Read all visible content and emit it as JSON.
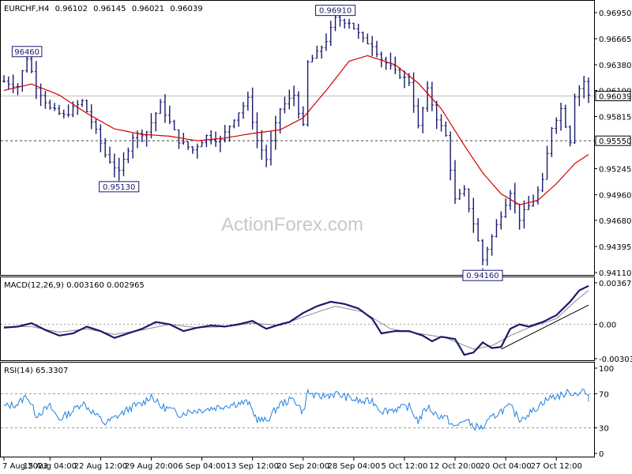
{
  "chart_data": [
    {
      "type": "candlestick",
      "header": {
        "symbol": "EURCHF,H4",
        "open": "0.96102",
        "high": "0.96145",
        "low": "0.96021",
        "close": "0.96039"
      },
      "y_ticks": [
        "0.96950",
        "0.96665",
        "0.96380",
        "0.96100",
        "0.95815",
        "0.95530",
        "0.95245",
        "0.94960",
        "0.94680",
        "0.94395",
        "0.94110"
      ],
      "ylim": [
        0.9411,
        0.9695
      ],
      "current_price": "0.96039",
      "horizontal_level": "0.95550",
      "annotations": [
        {
          "text": "0.96910",
          "value": 0.9691,
          "bar": 72
        },
        {
          "text": "96460",
          "value": 0.9646,
          "bar": 5
        },
        {
          "text": "0.95130",
          "value": 0.9513,
          "bar": 25
        },
        {
          "text": "0.94160",
          "value": 0.9416,
          "bar": 104
        }
      ],
      "x_ticks": [
        {
          "label": "7 Aug 2023",
          "bar": 0
        },
        {
          "label": "15 Aug 04:00",
          "bar": 10
        },
        {
          "label": "22 Aug 12:00",
          "bar": 21
        },
        {
          "label": "29 Aug 20:00",
          "bar": 32
        },
        {
          "label": "6 Sep 04:00",
          "bar": 43
        },
        {
          "label": "13 Sep 12:00",
          "bar": 54
        },
        {
          "label": "20 Sep 20:00",
          "bar": 65
        },
        {
          "label": "28 Sep 04:00",
          "bar": 76
        },
        {
          "label": "5 Oct 12:00",
          "bar": 87
        },
        {
          "label": "12 Oct 20:00",
          "bar": 98
        },
        {
          "label": "20 Oct 04:00",
          "bar": 109
        },
        {
          "label": "27 Oct 12:00",
          "bar": 120
        }
      ],
      "close_anchors": [
        [
          0,
          0.962
        ],
        [
          3,
          0.9615
        ],
        [
          5,
          0.9646
        ],
        [
          7,
          0.9615
        ],
        [
          10,
          0.959
        ],
        [
          13,
          0.9582
        ],
        [
          17,
          0.9598
        ],
        [
          20,
          0.9565
        ],
        [
          22,
          0.954
        ],
        [
          25,
          0.952
        ],
        [
          28,
          0.956
        ],
        [
          31,
          0.9565
        ],
        [
          34,
          0.9595
        ],
        [
          36,
          0.9575
        ],
        [
          38,
          0.9555
        ],
        [
          41,
          0.9545
        ],
        [
          44,
          0.956
        ],
        [
          47,
          0.9555
        ],
        [
          50,
          0.958
        ],
        [
          53,
          0.96
        ],
        [
          55,
          0.9555
        ],
        [
          57,
          0.9535
        ],
        [
          60,
          0.959
        ],
        [
          63,
          0.9605
        ],
        [
          65,
          0.957
        ],
        [
          66,
          0.964
        ],
        [
          68,
          0.965
        ],
        [
          70,
          0.9665
        ],
        [
          72,
          0.9688
        ],
        [
          75,
          0.9685
        ],
        [
          78,
          0.9665
        ],
        [
          80,
          0.966
        ],
        [
          82,
          0.9645
        ],
        [
          85,
          0.963
        ],
        [
          88,
          0.962
        ],
        [
          90,
          0.957
        ],
        [
          92,
          0.961
        ],
        [
          94,
          0.958
        ],
        [
          96,
          0.956
        ],
        [
          98,
          0.949
        ],
        [
          100,
          0.95
        ],
        [
          102,
          0.9465
        ],
        [
          104,
          0.9425
        ],
        [
          106,
          0.945
        ],
        [
          108,
          0.9475
        ],
        [
          110,
          0.95
        ],
        [
          112,
          0.947
        ],
        [
          115,
          0.949
        ],
        [
          117,
          0.951
        ],
        [
          119,
          0.957
        ],
        [
          121,
          0.959
        ],
        [
          123,
          0.9555
        ],
        [
          124,
          0.9605
        ],
        [
          126,
          0.962
        ],
        [
          127,
          0.9604
        ]
      ],
      "ma_anchors": [
        [
          0,
          0.961
        ],
        [
          6,
          0.9617
        ],
        [
          12,
          0.9605
        ],
        [
          18,
          0.9585
        ],
        [
          24,
          0.9568
        ],
        [
          30,
          0.9562
        ],
        [
          36,
          0.956
        ],
        [
          42,
          0.9555
        ],
        [
          48,
          0.9558
        ],
        [
          54,
          0.9563
        ],
        [
          60,
          0.9567
        ],
        [
          65,
          0.958
        ],
        [
          70,
          0.961
        ],
        [
          75,
          0.9642
        ],
        [
          79,
          0.9648
        ],
        [
          85,
          0.9638
        ],
        [
          90,
          0.9618
        ],
        [
          95,
          0.959
        ],
        [
          100,
          0.955
        ],
        [
          104,
          0.952
        ],
        [
          108,
          0.9497
        ],
        [
          112,
          0.9485
        ],
        [
          116,
          0.949
        ],
        [
          120,
          0.9508
        ],
        [
          124,
          0.953
        ],
        [
          127,
          0.954
        ]
      ],
      "total_bars": 128
    },
    {
      "type": "line",
      "title": "MACD(12,26,9) 0.003160 0.002965",
      "y_ticks": [
        "0.00367",
        "0.00",
        "-0.003038"
      ],
      "ylim": [
        -0.003038,
        0.00367
      ],
      "macd_anchors": [
        [
          0,
          -0.0003
        ],
        [
          3,
          -0.0002
        ],
        [
          6,
          0.0001
        ],
        [
          9,
          -0.0005
        ],
        [
          12,
          -0.001
        ],
        [
          15,
          -0.0008
        ],
        [
          18,
          -0.0002
        ],
        [
          21,
          -0.0006
        ],
        [
          24,
          -0.0012
        ],
        [
          27,
          -0.0008
        ],
        [
          30,
          -0.0004
        ],
        [
          33,
          0.0002
        ],
        [
          36,
          0.0
        ],
        [
          39,
          -0.0006
        ],
        [
          42,
          -0.0003
        ],
        [
          45,
          -0.0001
        ],
        [
          48,
          -0.0002
        ],
        [
          51,
          0.0
        ],
        [
          54,
          0.0003
        ],
        [
          57,
          -0.0004
        ],
        [
          60,
          0.0
        ],
        [
          62,
          0.0002
        ],
        [
          65,
          0.001
        ],
        [
          68,
          0.0016
        ],
        [
          71,
          0.002
        ],
        [
          74,
          0.0018
        ],
        [
          77,
          0.0014
        ],
        [
          80,
          0.0005
        ],
        [
          82,
          -0.0008
        ],
        [
          85,
          -0.0006
        ],
        [
          88,
          -0.0006
        ],
        [
          91,
          -0.001
        ],
        [
          93,
          -0.0015
        ],
        [
          95,
          -0.0011
        ],
        [
          98,
          -0.0013
        ],
        [
          100,
          -0.0027
        ],
        [
          102,
          -0.0025
        ],
        [
          104,
          -0.0016
        ],
        [
          106,
          -0.0021
        ],
        [
          108,
          -0.002
        ],
        [
          110,
          -0.0004
        ],
        [
          112,
          0.0
        ],
        [
          114,
          -0.0002
        ],
        [
          117,
          0.0002
        ],
        [
          120,
          0.0008
        ],
        [
          123,
          0.002
        ],
        [
          125,
          0.003
        ],
        [
          127,
          0.0034
        ]
      ],
      "signal_anchors": [
        [
          0,
          -0.0002
        ],
        [
          6,
          -0.0002
        ],
        [
          12,
          -0.0007
        ],
        [
          18,
          -0.0004
        ],
        [
          24,
          -0.0009
        ],
        [
          30,
          -0.0005
        ],
        [
          36,
          0.0
        ],
        [
          42,
          -0.0003
        ],
        [
          48,
          -0.0002
        ],
        [
          54,
          0.0001
        ],
        [
          60,
          -0.0001
        ],
        [
          66,
          0.0008
        ],
        [
          72,
          0.0016
        ],
        [
          78,
          0.0011
        ],
        [
          84,
          -0.0004
        ],
        [
          90,
          -0.0008
        ],
        [
          96,
          -0.0012
        ],
        [
          102,
          -0.0022
        ],
        [
          106,
          -0.0019
        ],
        [
          110,
          -0.001
        ],
        [
          114,
          -0.0003
        ],
        [
          120,
          0.0005
        ],
        [
          124,
          0.002
        ],
        [
          127,
          0.003
        ]
      ],
      "trendline": {
        "from": [
          108,
          -0.0022
        ],
        "to": [
          127,
          0.0017
        ]
      }
    },
    {
      "type": "line",
      "title": "RSI(14) 65.3307",
      "y_ticks": [
        "100",
        "70",
        "30",
        "0"
      ],
      "ylim": [
        0,
        100
      ],
      "levels": [
        70,
        30
      ],
      "rsi_anchors": [
        [
          0,
          55
        ],
        [
          3,
          58
        ],
        [
          5,
          68
        ],
        [
          7,
          45
        ],
        [
          10,
          55
        ],
        [
          12,
          40
        ],
        [
          15,
          50
        ],
        [
          17,
          60
        ],
        [
          20,
          45
        ],
        [
          22,
          35
        ],
        [
          25,
          45
        ],
        [
          28,
          55
        ],
        [
          30,
          58
        ],
        [
          32,
          68
        ],
        [
          34,
          55
        ],
        [
          36,
          52
        ],
        [
          38,
          46
        ],
        [
          41,
          50
        ],
        [
          44,
          52
        ],
        [
          47,
          55
        ],
        [
          50,
          58
        ],
        [
          53,
          60
        ],
        [
          55,
          40
        ],
        [
          57,
          38
        ],
        [
          60,
          58
        ],
        [
          63,
          64
        ],
        [
          65,
          48
        ],
        [
          66,
          72
        ],
        [
          68,
          66
        ],
        [
          70,
          68
        ],
        [
          72,
          70
        ],
        [
          75,
          65
        ],
        [
          78,
          60
        ],
        [
          80,
          62
        ],
        [
          82,
          50
        ],
        [
          85,
          52
        ],
        [
          88,
          55
        ],
        [
          90,
          38
        ],
        [
          92,
          55
        ],
        [
          94,
          45
        ],
        [
          96,
          42
        ],
        [
          98,
          30
        ],
        [
          100,
          40
        ],
        [
          102,
          32
        ],
        [
          104,
          30
        ],
        [
          106,
          42
        ],
        [
          108,
          50
        ],
        [
          110,
          55
        ],
        [
          112,
          40
        ],
        [
          115,
          50
        ],
        [
          117,
          60
        ],
        [
          119,
          66
        ],
        [
          121,
          68
        ],
        [
          123,
          72
        ],
        [
          124,
          70
        ],
        [
          126,
          74
        ],
        [
          127,
          65
        ]
      ]
    }
  ],
  "watermark": "ActionForex.com",
  "colors": {
    "candle": "#1a1a6e",
    "ma": "#d40000",
    "macd": "#1a1a6e",
    "signal": "#8a8a8a",
    "rsi": "#2080e0",
    "grid": "#9a9a9a",
    "level": "#9a9a9a"
  }
}
